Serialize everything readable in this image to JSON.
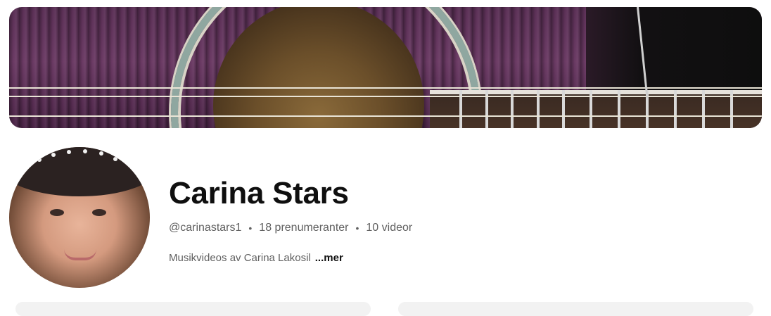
{
  "channel": {
    "name": "Carina Stars",
    "handle": "@carinastars1",
    "subscribers": "18 prenumeranter",
    "videos": "10 videor",
    "separator": "•",
    "description": "Musikvideos av Carina Lakosil",
    "more_label": "...mer"
  },
  "colors": {
    "text_primary": "#0f0f0f",
    "text_secondary": "#606060",
    "background": "#ffffff"
  }
}
